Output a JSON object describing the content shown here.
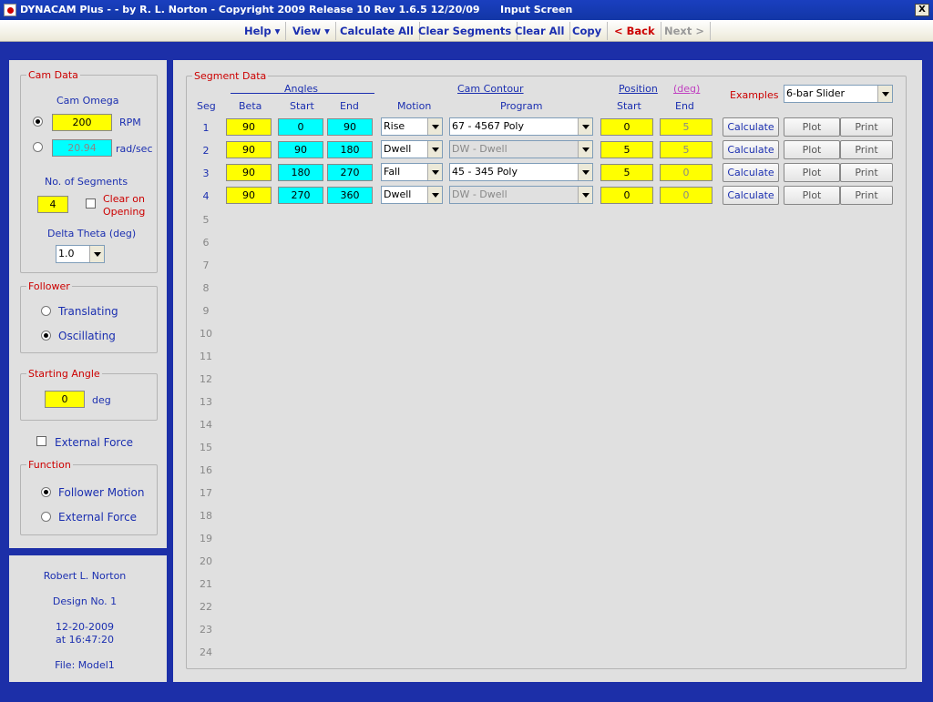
{
  "window": {
    "title": "DYNACAM Plus - - by R. L. Norton - Copyright 2009 Release 10  Rev 1.6.5  12/20/09",
    "subtitle": "Input Screen",
    "close_label": "X"
  },
  "menu": {
    "help": "Help ▾",
    "view": "View ▾",
    "calculate_all": "Calculate All",
    "clear_segments": "Clear Segments",
    "clear_all": "Clear All",
    "copy": "Copy",
    "back": "< Back",
    "next": "Next >"
  },
  "cam_data": {
    "legend": "Cam Data",
    "omega_label": "Cam Omega",
    "rpm_value": "200",
    "rpm_unit": "RPM",
    "radsec_value": "20.94",
    "radsec_unit": "rad/sec",
    "segments_label": "No. of Segments",
    "segments_value": "4",
    "clear_on_opening_line1": "Clear on",
    "clear_on_opening_line2": "Opening",
    "delta_theta_label": "Delta Theta (deg)",
    "delta_theta_value": "1.0",
    "omega_unit_selected": "RPM",
    "clear_on_opening_checked": false
  },
  "follower": {
    "legend": "Follower",
    "translating": "Translating",
    "oscillating": "Oscillating",
    "selected": "Oscillating"
  },
  "starting_angle": {
    "legend": "Starting Angle",
    "value": "0",
    "unit": "deg"
  },
  "external_force": {
    "label": "External Force",
    "checked": false
  },
  "function": {
    "legend": "Function",
    "follower_motion": "Follower Motion",
    "external_force": "External Force",
    "selected": "Follower Motion"
  },
  "info": {
    "author": "Robert L. Norton",
    "design": "Design No. 1",
    "date": "12-20-2009",
    "time": "at 16:47:20",
    "file": "File: Model1"
  },
  "segment_data": {
    "legend": "Segment Data",
    "angles_header": "Angles",
    "cam_contour_header": "Cam Contour",
    "position_header": "Position",
    "deg_header": "(deg)",
    "examples_label": "Examples",
    "examples_value": "6-bar Slider",
    "columns": {
      "seg": "Seg",
      "beta": "Beta",
      "start": "Start",
      "end": "End",
      "motion": "Motion",
      "program": "Program",
      "pos_start": "Start",
      "pos_end": "End"
    },
    "rows": [
      {
        "seg": "1",
        "beta": "90",
        "start": "0",
        "end": "90",
        "motion": "Rise",
        "program": "67 - 4567 Poly",
        "pos_start": "0",
        "pos_end": "5",
        "program_enabled": true
      },
      {
        "seg": "2",
        "beta": "90",
        "start": "90",
        "end": "180",
        "motion": "Dwell",
        "program": "DW - Dwell",
        "pos_start": "5",
        "pos_end": "5",
        "program_enabled": false
      },
      {
        "seg": "3",
        "beta": "90",
        "start": "180",
        "end": "270",
        "motion": "Fall",
        "program": "45 - 345 Poly",
        "pos_start": "5",
        "pos_end": "0",
        "program_enabled": true
      },
      {
        "seg": "4",
        "beta": "90",
        "start": "270",
        "end": "360",
        "motion": "Dwell",
        "program": "DW - Dwell",
        "pos_start": "0",
        "pos_end": "0",
        "program_enabled": false
      }
    ],
    "empty_rows": [
      "5",
      "6",
      "7",
      "8",
      "9",
      "10",
      "11",
      "12",
      "13",
      "14",
      "15",
      "16",
      "17",
      "18",
      "19",
      "20",
      "21",
      "22",
      "23",
      "24"
    ],
    "row_buttons": {
      "calculate": "Calculate",
      "plot": "Plot",
      "print": "Print"
    }
  }
}
